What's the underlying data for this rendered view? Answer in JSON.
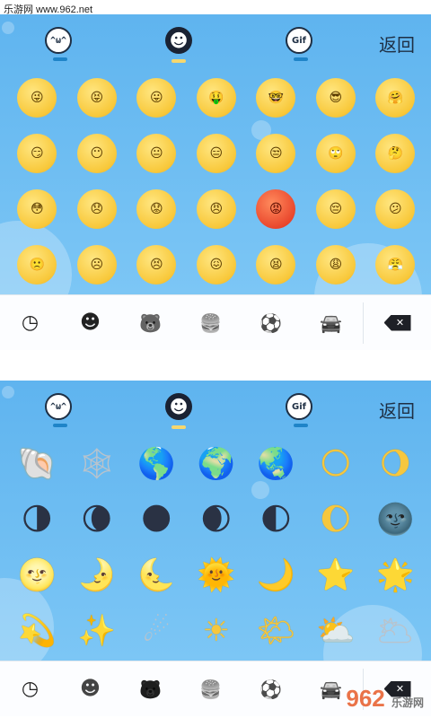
{
  "watermark_top": "乐游网 www.962.net",
  "watermark_bottom": "962",
  "watermark_bottom_sub": "乐游网",
  "tabs": {
    "kaomoji": "^ω^",
    "emoji": "☻",
    "gif": "Gif"
  },
  "back_label": "返回",
  "panel1_emojis": [
    "😜",
    "😝",
    "😛",
    "🤑",
    "🤓",
    "😎",
    "🤗",
    "😏",
    "😶",
    "😐",
    "😑",
    "😒",
    "🙄",
    "🤔",
    "😳",
    "😞",
    "😟",
    "😠",
    "😡",
    "😔",
    "😕",
    "🙁",
    "☹",
    "😣",
    "😖",
    "😫",
    "😩",
    "😤"
  ],
  "panel2_emojis": [
    "🐚",
    "🕸",
    "🌎",
    "🌍",
    "🌏",
    "🌕",
    "🌖",
    "🌗",
    "🌘",
    "🌑",
    "🌒",
    "🌓",
    "🌔",
    "🌚",
    "🌝",
    "🌛",
    "🌜",
    "🌞",
    "🌙",
    "⭐",
    "🌟",
    "💫",
    "✨",
    "☄",
    "☀",
    "🌤",
    "⛅",
    "🌥"
  ],
  "bottom_icons": {
    "recent": "◷",
    "smileys": "☻",
    "animals": "🐻",
    "food": "🍔",
    "activity": "⚽",
    "travel": "🚘",
    "delete": "✕"
  }
}
